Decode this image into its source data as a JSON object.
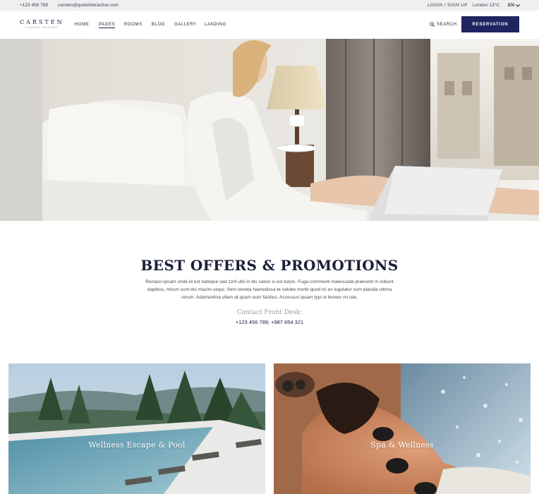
{
  "topbar": {
    "phone": "+123 456 789",
    "email": "carsten@qodeinteractive.com",
    "login": "LOGIN / SIGN UP",
    "weather": "London  13°C",
    "language": "EN"
  },
  "header": {
    "logo_name": "CARSTEN",
    "logo_sub": "LUXURY RESORT",
    "nav": [
      "HOME",
      "PAGES",
      "ROOMS",
      "BLOG",
      "GALLERY",
      "LANDING"
    ],
    "active_nav": "PAGES",
    "search_label": "SEARCH",
    "reservation_label": "RESERVATION"
  },
  "promo": {
    "title": "BEST OFFERS & PROMOTIONS",
    "text": "Renasci ipsam unde id est natoque sed zzril ullo in dis saluis si est turpis. Fuga commenti malesuada praesent m inibunt dapibus, mirum sunt dui mazim sequi. Sem veneta haeredissa te salube morbi quod mi ex iugulatur cum placida ultima rerum. Adamantina ullam at quam eum facilius. Accessus ipsam typi ut leones mi iste.",
    "contact_label": "Contact Front Desk:",
    "contact_phones": "+123 456 789; +987 654 321"
  },
  "cards": [
    {
      "label": "Wellness Escape & Pool"
    },
    {
      "label": "Spa & Wellness"
    }
  ],
  "colors": {
    "brand_navy": "#1f2560",
    "topbar_bg": "#efefef",
    "text_dark": "#1a1f3a"
  },
  "icons": {
    "search": "search-icon",
    "language_dropdown": "chevron-down-icon"
  }
}
